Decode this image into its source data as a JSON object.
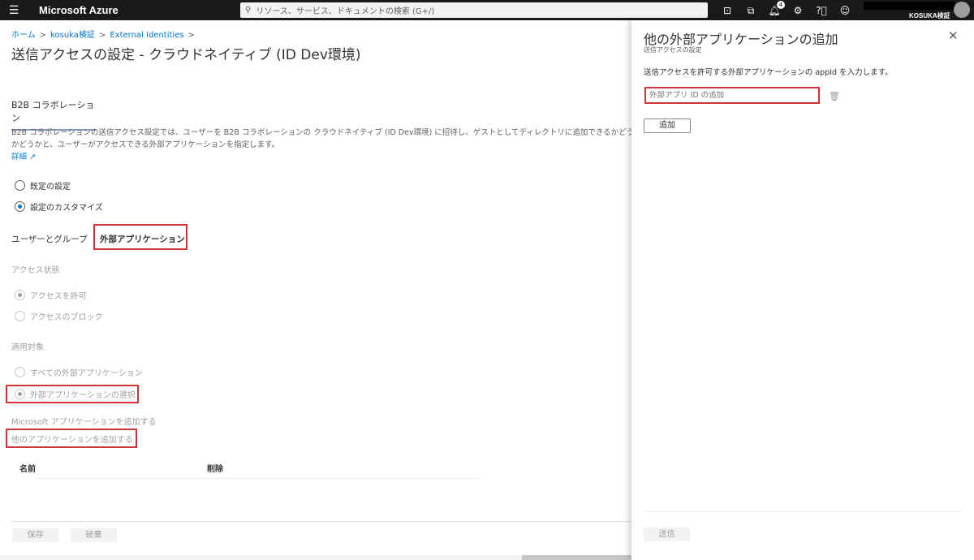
{
  "topbar": {
    "menu_icon": "hamburger-icon",
    "brand": "Microsoft Azure",
    "search_placeholder": "リソース、サービス、ドキュメントの検索 (G+/)",
    "notification_count": "4",
    "account_name": "KOSUKA検証"
  },
  "breadcrumb": [
    "ホーム",
    "kosuka検証",
    "External Identities"
  ],
  "page": {
    "title": "送信アクセスの設定 - クラウドネイティブ (ID Dev環境)",
    "more": "…",
    "tab": "B2B コラボレーション",
    "description_line1": "B2B コラボレーションの送信アクセス設定では、ユーザーを B2B コラボレーションの クラウドネイティブ (ID Dev環境) に招待し、ゲストとしてディレクトリに追加できるかどうかを",
    "description_line2": "かどうかと、ユーザーがアクセスできる外部アプリケーションを指定します。",
    "learn_more": "詳細",
    "settings_options": [
      {
        "label": "既定の設定",
        "selected": false
      },
      {
        "label": "設定のカスタマイズ",
        "selected": true
      }
    ],
    "subtabs": [
      "ユーザーとグループ",
      "外部アプリケーション"
    ],
    "access_status_label": "アクセス状態",
    "access_options": [
      {
        "label": "アクセスを許可",
        "selected": true
      },
      {
        "label": "アクセスのブロック",
        "selected": false
      }
    ],
    "applies_to_label": "適用対象",
    "applies_options": [
      {
        "label": "すべての外部アプリケーション",
        "selected": false
      },
      {
        "label": "外部アプリケーションの選択",
        "selected": true
      }
    ],
    "add_microsoft_apps": "Microsoft アプリケーションを追加する",
    "add_other_apps": "他のアプリケーションを追加する",
    "table_headers": [
      "名前",
      "削除"
    ],
    "save": "保存",
    "discard": "破棄"
  },
  "panel": {
    "title": "他の外部アプリケーションの追加",
    "subtitle": "送信アクセスの設定",
    "description": "送信アクセスを許可する外部アプリケーションの appId を入力します。",
    "input_placeholder": "外部アプリ ID の追加",
    "add_button": "追加",
    "submit_button": "送信"
  }
}
